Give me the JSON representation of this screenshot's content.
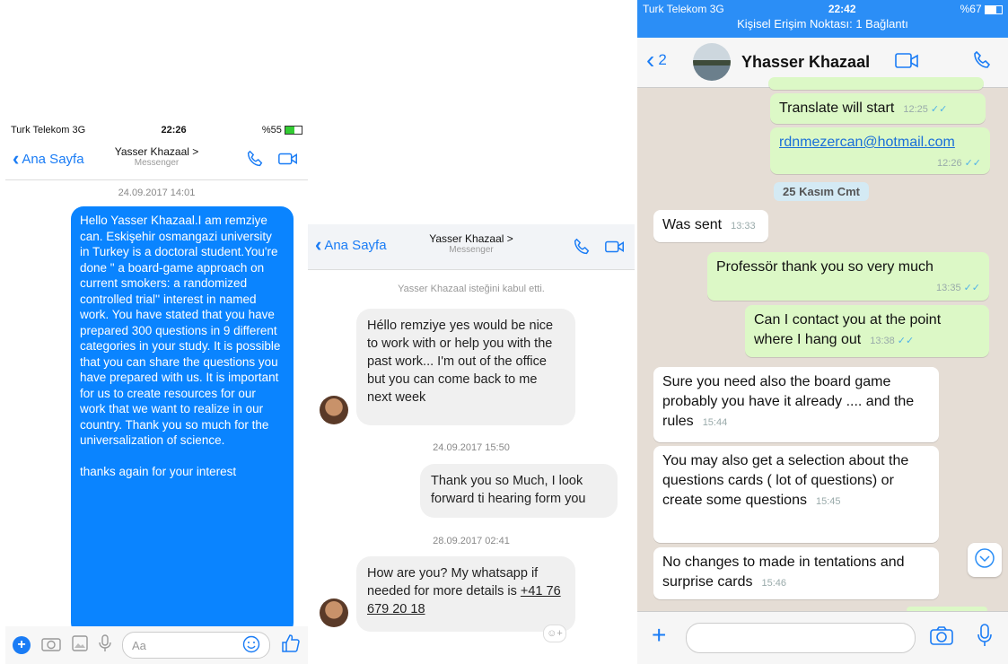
{
  "panel1": {
    "status": {
      "carrier": "Turk Telekom 3G",
      "time": "22:26",
      "battery": "%55"
    },
    "header": {
      "back_label": "Ana Sayfa",
      "contact_name": "Yasser Khazaal >",
      "subtitle": "Messenger"
    },
    "date_stamp": "24.09.2017 14:01",
    "message": "Hello Yasser Khazaal.I am remziye can. Eskişehir osmangazi university in Turkey is a doctoral student.You're done \" a board-game approach on current smokers: a randomized controlled trial'' interest in named work. You have stated that you have prepared 300 questions in 9 different categories in your study. It is possible that you can share the questions you have prepared with us. It is important for us to create resources for our work that we want to realize in our country. Thank you so much for the universalization of science.",
    "message_tail": "thanks again for your interest",
    "composer_placeholder": "Aa",
    "colors": {
      "accent": "#0a84ff"
    }
  },
  "panel2": {
    "header": {
      "back_label": "Ana Sayfa",
      "contact_name": "Yasser Khazaal >",
      "subtitle": "Messenger"
    },
    "system_note": "Yasser Khazaal isteğini kabul etti.",
    "msg1": "Héllo remziye yes would be nice to work with or help you with the past work... I'm out of the office but you can come back to me next week",
    "date2": "24.09.2017 15:50",
    "msg2": "Thank you so Much, I look forward ti hearing form you",
    "date3": "28.09.2017 02:41",
    "msg3": "How are you? My whatsapp if needed for more details is",
    "msg3_phone": "+41 76 679 20 18"
  },
  "panel3": {
    "status": {
      "carrier": "Turk Telekom 3G",
      "time": "22:42",
      "battery": "%67",
      "hotspot": "Kişisel Erişim Noktası: 1 Bağlantı"
    },
    "header": {
      "back_count": "2",
      "contact_name": "Yhasser Khazaal"
    },
    "messages": [
      {
        "text": "Translate will start",
        "time": "12:25"
      },
      {
        "text": "rdnmezercan@hotmail.com",
        "time": "12:26"
      },
      {
        "text": "Was sent",
        "time": "13:33"
      },
      {
        "text": "Professör thank you so very much",
        "time": "13:35"
      },
      {
        "text": "Can I contact you at the point where I hang out",
        "time": "13:38"
      },
      {
        "text": "Sure you need also the board game probably you have it already .... and the rules",
        "time": "15:44"
      },
      {
        "text": "You may also get a selection about the questions cards ( lot of questions) or create some questions",
        "time": "15:45"
      },
      {
        "text": "No changes to made in tentations and surprise cards",
        "time": "15:46"
      }
    ],
    "day_badge": "25 Kasım Cmt",
    "colors": {
      "header": "#2b8ef6",
      "outgoing": "#dcf8c6",
      "incoming": "#ffffff"
    }
  }
}
